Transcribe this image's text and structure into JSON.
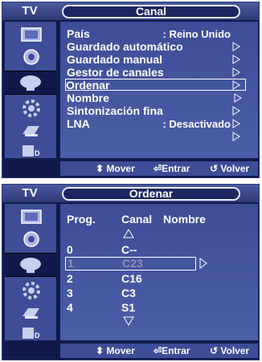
{
  "screen1": {
    "tv_label": "TV",
    "title": "Canal",
    "menu": [
      {
        "label": "País",
        "value": ": Reino Unido"
      },
      {
        "label": "Guardado automático",
        "value": ""
      },
      {
        "label": "Guardado manual",
        "value": ""
      },
      {
        "label": "Gestor de canales",
        "value": ""
      },
      {
        "label": "Ordenar",
        "value": ""
      },
      {
        "label": "Nombre",
        "value": ""
      },
      {
        "label": "Sintonización fina",
        "value": ""
      },
      {
        "label": "LNA",
        "value": ": Desactivado"
      }
    ],
    "highlighted_index": 4,
    "footer": {
      "move": "Mover",
      "enter": "Entrar",
      "back": "Volver"
    }
  },
  "screen2": {
    "tv_label": "TV",
    "title": "Ordenar",
    "headers": {
      "prog": "Prog.",
      "canal": "Canal",
      "nombre": "Nombre"
    },
    "rows": [
      {
        "prog": "0",
        "canal": "C--"
      },
      {
        "prog": "1",
        "canal": "C23"
      },
      {
        "prog": "2",
        "canal": "C16"
      },
      {
        "prog": "3",
        "canal": "C3"
      },
      {
        "prog": "4",
        "canal": "S1"
      }
    ],
    "highlighted_index": 1,
    "footer": {
      "move": "Mover",
      "enter": "Entrar",
      "back": "Volver"
    }
  },
  "sidebar_icons": [
    "picture-icon",
    "sound-icon",
    "channel-icon",
    "setup-icon",
    "input-icon",
    "digital-icon"
  ],
  "colors": {
    "background": "#101a4a",
    "panel": "#3d4d97",
    "header": "#4b5aa0",
    "dim_text": "#8a90b8"
  }
}
